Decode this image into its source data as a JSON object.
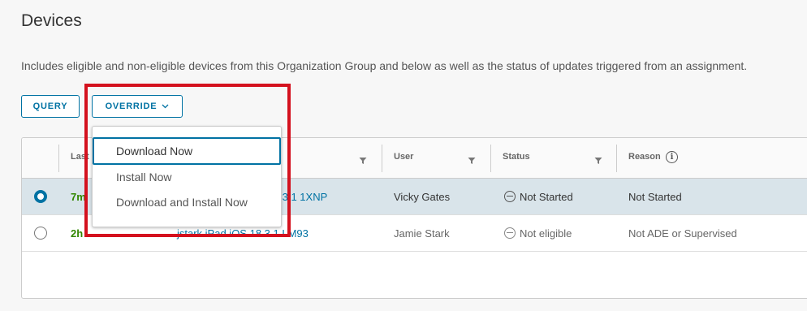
{
  "page": {
    "title": "Devices",
    "description": "Includes eligible and non-eligible devices from this Organization Group and below as well as the status of updates triggered from an assignment."
  },
  "toolbar": {
    "query_label": "QUERY",
    "override_label": "OVERRIDE"
  },
  "override_menu": {
    "items": [
      {
        "label": "Download Now",
        "focused": true
      },
      {
        "label": "Install Now"
      },
      {
        "label": "Download and Install Now"
      }
    ]
  },
  "grid": {
    "columns": {
      "last": "Last",
      "user": "User",
      "status": "Status",
      "reason": "Reason"
    },
    "rows": [
      {
        "selected": true,
        "last_visible": "7m",
        "device_visible": ".3.1 1XNP",
        "user": "Vicky Gates",
        "status": "Not Started",
        "reason": "Not Started"
      },
      {
        "selected": false,
        "last_visible": "2h",
        "device_visible": "jstark iPad iOS 18.3.1 LM93",
        "user": "Jamie Stark",
        "status": "Not eligible",
        "reason": "Not ADE or Supervised"
      }
    ]
  },
  "colors": {
    "accent": "#0072a3",
    "highlight": "#d4111e",
    "recent_time": "#318700",
    "selected_row": "#d9e4ea"
  }
}
